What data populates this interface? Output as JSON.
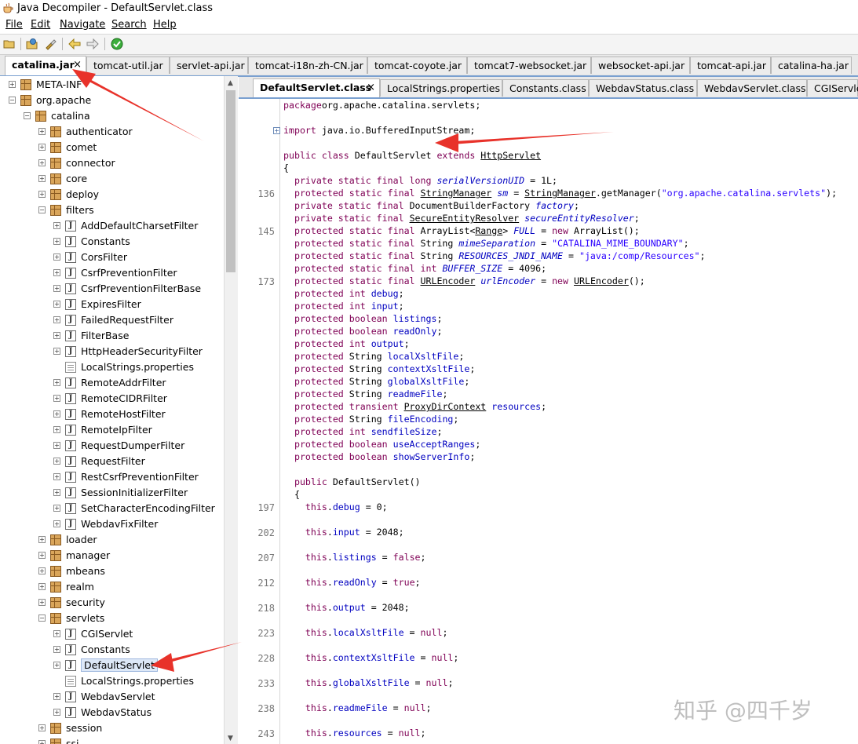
{
  "window": {
    "title": "Java Decompiler - DefaultServlet.class"
  },
  "menu": [
    "File",
    "Edit",
    "Navigate",
    "Search",
    "Help"
  ],
  "jar_tabs": [
    "catalina.jar",
    "tomcat-util.jar",
    "servlet-api.jar",
    "tomcat-i18n-zh-CN.jar",
    "tomcat-coyote.jar",
    "tomcat7-websocket.jar",
    "websocket-api.jar",
    "tomcat-api.jar",
    "catalina-ha.jar"
  ],
  "tree": [
    {
      "label": "META-INF",
      "depth": 0,
      "icon": "package",
      "expander": "+"
    },
    {
      "label": "org.apache",
      "depth": 0,
      "icon": "package",
      "expander": "-"
    },
    {
      "label": "catalina",
      "depth": 1,
      "icon": "package",
      "expander": "-"
    },
    {
      "label": "authenticator",
      "depth": 2,
      "icon": "package",
      "expander": "+"
    },
    {
      "label": "comet",
      "depth": 2,
      "icon": "package",
      "expander": "+"
    },
    {
      "label": "connector",
      "depth": 2,
      "icon": "package",
      "expander": "+"
    },
    {
      "label": "core",
      "depth": 2,
      "icon": "package",
      "expander": "+"
    },
    {
      "label": "deploy",
      "depth": 2,
      "icon": "package",
      "expander": "+"
    },
    {
      "label": "filters",
      "depth": 2,
      "icon": "package",
      "expander": "-"
    },
    {
      "label": "AddDefaultCharsetFilter",
      "depth": 3,
      "icon": "class",
      "expander": "+"
    },
    {
      "label": "Constants",
      "depth": 3,
      "icon": "class",
      "expander": "+"
    },
    {
      "label": "CorsFilter",
      "depth": 3,
      "icon": "class",
      "expander": "+"
    },
    {
      "label": "CsrfPreventionFilter",
      "depth": 3,
      "icon": "class",
      "expander": "+"
    },
    {
      "label": "CsrfPreventionFilterBase",
      "depth": 3,
      "icon": "class",
      "expander": "+"
    },
    {
      "label": "ExpiresFilter",
      "depth": 3,
      "icon": "class",
      "expander": "+"
    },
    {
      "label": "FailedRequestFilter",
      "depth": 3,
      "icon": "class",
      "expander": "+"
    },
    {
      "label": "FilterBase",
      "depth": 3,
      "icon": "class",
      "expander": "+"
    },
    {
      "label": "HttpHeaderSecurityFilter",
      "depth": 3,
      "icon": "class",
      "expander": "+"
    },
    {
      "label": "LocalStrings.properties",
      "depth": 3,
      "icon": "properties",
      "expander": ""
    },
    {
      "label": "RemoteAddrFilter",
      "depth": 3,
      "icon": "class",
      "expander": "+"
    },
    {
      "label": "RemoteCIDRFilter",
      "depth": 3,
      "icon": "class",
      "expander": "+"
    },
    {
      "label": "RemoteHostFilter",
      "depth": 3,
      "icon": "class",
      "expander": "+"
    },
    {
      "label": "RemoteIpFilter",
      "depth": 3,
      "icon": "class",
      "expander": "+"
    },
    {
      "label": "RequestDumperFilter",
      "depth": 3,
      "icon": "class",
      "expander": "+"
    },
    {
      "label": "RequestFilter",
      "depth": 3,
      "icon": "class",
      "expander": "+"
    },
    {
      "label": "RestCsrfPreventionFilter",
      "depth": 3,
      "icon": "class",
      "expander": "+"
    },
    {
      "label": "SessionInitializerFilter",
      "depth": 3,
      "icon": "class",
      "expander": "+"
    },
    {
      "label": "SetCharacterEncodingFilter",
      "depth": 3,
      "icon": "class",
      "expander": "+"
    },
    {
      "label": "WebdavFixFilter",
      "depth": 3,
      "icon": "class",
      "expander": "+"
    },
    {
      "label": "loader",
      "depth": 2,
      "icon": "package",
      "expander": "+"
    },
    {
      "label": "manager",
      "depth": 2,
      "icon": "package",
      "expander": "+"
    },
    {
      "label": "mbeans",
      "depth": 2,
      "icon": "package",
      "expander": "+"
    },
    {
      "label": "realm",
      "depth": 2,
      "icon": "package",
      "expander": "+"
    },
    {
      "label": "security",
      "depth": 2,
      "icon": "package",
      "expander": "+"
    },
    {
      "label": "servlets",
      "depth": 2,
      "icon": "package",
      "expander": "-"
    },
    {
      "label": "CGIServlet",
      "depth": 3,
      "icon": "class",
      "expander": "+"
    },
    {
      "label": "Constants",
      "depth": 3,
      "icon": "class",
      "expander": "+"
    },
    {
      "label": "DefaultServlet",
      "depth": 3,
      "icon": "class",
      "expander": "+",
      "selected": true
    },
    {
      "label": "LocalStrings.properties",
      "depth": 3,
      "icon": "properties",
      "expander": ""
    },
    {
      "label": "WebdavServlet",
      "depth": 3,
      "icon": "class",
      "expander": "+"
    },
    {
      "label": "WebdavStatus",
      "depth": 3,
      "icon": "class",
      "expander": "+"
    },
    {
      "label": "session",
      "depth": 2,
      "icon": "package",
      "expander": "+"
    },
    {
      "label": "ssi",
      "depth": 2,
      "icon": "package",
      "expander": "+"
    }
  ],
  "class_tabs": [
    "DefaultServlet.class",
    "LocalStrings.properties",
    "Constants.class",
    "WebdavStatus.class",
    "WebdavServlet.class",
    "CGIServlet"
  ],
  "code": [
    {
      "ln": "",
      "segs": [
        [
          "kw",
          "package"
        ],
        [
          "",
          "org.apache.catalina.servlets;"
        ]
      ]
    },
    {
      "ln": "",
      "segs": []
    },
    {
      "ln": "",
      "segs": [
        [
          "kw",
          "import"
        ],
        [
          "",
          " java.io.BufferedInputStream;"
        ]
      ]
    },
    {
      "ln": "",
      "segs": []
    },
    {
      "ln": "",
      "segs": [
        [
          "kw",
          "public class "
        ],
        [
          "",
          "DefaultServlet "
        ],
        [
          "kw",
          "extends "
        ],
        [
          "ul",
          "HttpServlet"
        ]
      ]
    },
    {
      "ln": "",
      "segs": [
        [
          "",
          "{"
        ]
      ]
    },
    {
      "ln": "",
      "segs": [
        [
          "",
          "  "
        ],
        [
          "kw",
          "private static final long "
        ],
        [
          "it",
          "serialVersionUID"
        ],
        [
          "",
          " = 1L;"
        ]
      ]
    },
    {
      "ln": "136",
      "segs": [
        [
          "",
          "  "
        ],
        [
          "kw",
          "protected static final "
        ],
        [
          "ul",
          "StringManager"
        ],
        [
          "",
          " "
        ],
        [
          "it",
          "sm"
        ],
        [
          "",
          " = "
        ],
        [
          "ul",
          "StringManager"
        ],
        [
          "",
          ".getManager("
        ],
        [
          "str",
          "\"org.apache.catalina.servlets\""
        ],
        [
          "",
          ");"
        ]
      ]
    },
    {
      "ln": "",
      "segs": [
        [
          "",
          "  "
        ],
        [
          "kw",
          "private static final "
        ],
        [
          "",
          "DocumentBuilderFactory "
        ],
        [
          "it",
          "factory"
        ],
        [
          "",
          ";"
        ]
      ]
    },
    {
      "ln": "",
      "segs": [
        [
          "",
          "  "
        ],
        [
          "kw",
          "private static final "
        ],
        [
          "ul",
          "SecureEntityResolver"
        ],
        [
          "",
          " "
        ],
        [
          "it",
          "secureEntityResolver"
        ],
        [
          "",
          ";"
        ]
      ]
    },
    {
      "ln": "145",
      "segs": [
        [
          "",
          "  "
        ],
        [
          "kw",
          "protected static final "
        ],
        [
          "",
          "ArrayList<"
        ],
        [
          "ul",
          "Range"
        ],
        [
          "",
          "> "
        ],
        [
          "it",
          "FULL"
        ],
        [
          "",
          " = "
        ],
        [
          "kw",
          "new "
        ],
        [
          "",
          "ArrayList();"
        ]
      ]
    },
    {
      "ln": "",
      "segs": [
        [
          "",
          "  "
        ],
        [
          "kw",
          "protected static final "
        ],
        [
          "",
          "String "
        ],
        [
          "it",
          "mimeSeparation"
        ],
        [
          "",
          " = "
        ],
        [
          "str",
          "\"CATALINA_MIME_BOUNDARY\""
        ],
        [
          "",
          ";"
        ]
      ]
    },
    {
      "ln": "",
      "segs": [
        [
          "",
          "  "
        ],
        [
          "kw",
          "protected static final "
        ],
        [
          "",
          "String "
        ],
        [
          "it",
          "RESOURCES_JNDI_NAME"
        ],
        [
          "",
          " = "
        ],
        [
          "str",
          "\"java:/comp/Resources\""
        ],
        [
          "",
          ";"
        ]
      ]
    },
    {
      "ln": "",
      "segs": [
        [
          "",
          "  "
        ],
        [
          "kw",
          "protected static final int "
        ],
        [
          "it",
          "BUFFER_SIZE"
        ],
        [
          "",
          " = 4096;"
        ]
      ]
    },
    {
      "ln": "173",
      "segs": [
        [
          "",
          "  "
        ],
        [
          "kw",
          "protected static final "
        ],
        [
          "ul",
          "URLEncoder"
        ],
        [
          "",
          " "
        ],
        [
          "it",
          "urlEncoder"
        ],
        [
          "",
          " = "
        ],
        [
          "kw",
          "new "
        ],
        [
          "ul",
          "URLEncoder"
        ],
        [
          "",
          "();"
        ]
      ]
    },
    {
      "ln": "",
      "segs": [
        [
          "",
          "  "
        ],
        [
          "kw",
          "protected int "
        ],
        [
          "fd",
          "debug"
        ],
        [
          "",
          ";"
        ]
      ]
    },
    {
      "ln": "",
      "segs": [
        [
          "",
          "  "
        ],
        [
          "kw",
          "protected int "
        ],
        [
          "fd",
          "input"
        ],
        [
          "",
          ";"
        ]
      ]
    },
    {
      "ln": "",
      "segs": [
        [
          "",
          "  "
        ],
        [
          "kw",
          "protected boolean "
        ],
        [
          "fd",
          "listings"
        ],
        [
          "",
          ";"
        ]
      ]
    },
    {
      "ln": "",
      "segs": [
        [
          "",
          "  "
        ],
        [
          "kw",
          "protected boolean "
        ],
        [
          "fd",
          "readOnly"
        ],
        [
          "",
          ";"
        ]
      ]
    },
    {
      "ln": "",
      "segs": [
        [
          "",
          "  "
        ],
        [
          "kw",
          "protected int "
        ],
        [
          "fd",
          "output"
        ],
        [
          "",
          ";"
        ]
      ]
    },
    {
      "ln": "",
      "segs": [
        [
          "",
          "  "
        ],
        [
          "kw",
          "protected "
        ],
        [
          "",
          "String "
        ],
        [
          "fd",
          "localXsltFile"
        ],
        [
          "",
          ";"
        ]
      ]
    },
    {
      "ln": "",
      "segs": [
        [
          "",
          "  "
        ],
        [
          "kw",
          "protected "
        ],
        [
          "",
          "String "
        ],
        [
          "fd",
          "contextXsltFile"
        ],
        [
          "",
          ";"
        ]
      ]
    },
    {
      "ln": "",
      "segs": [
        [
          "",
          "  "
        ],
        [
          "kw",
          "protected "
        ],
        [
          "",
          "String "
        ],
        [
          "fd",
          "globalXsltFile"
        ],
        [
          "",
          ";"
        ]
      ]
    },
    {
      "ln": "",
      "segs": [
        [
          "",
          "  "
        ],
        [
          "kw",
          "protected "
        ],
        [
          "",
          "String "
        ],
        [
          "fd",
          "readmeFile"
        ],
        [
          "",
          ";"
        ]
      ]
    },
    {
      "ln": "",
      "segs": [
        [
          "",
          "  "
        ],
        [
          "kw",
          "protected transient "
        ],
        [
          "ul",
          "ProxyDirContext"
        ],
        [
          "",
          " "
        ],
        [
          "fd",
          "resources"
        ],
        [
          "",
          ";"
        ]
      ]
    },
    {
      "ln": "",
      "segs": [
        [
          "",
          "  "
        ],
        [
          "kw",
          "protected "
        ],
        [
          "",
          "String "
        ],
        [
          "fd",
          "fileEncoding"
        ],
        [
          "",
          ";"
        ]
      ]
    },
    {
      "ln": "",
      "segs": [
        [
          "",
          "  "
        ],
        [
          "kw",
          "protected int "
        ],
        [
          "fd",
          "sendfileSize"
        ],
        [
          "",
          ";"
        ]
      ]
    },
    {
      "ln": "",
      "segs": [
        [
          "",
          "  "
        ],
        [
          "kw",
          "protected boolean "
        ],
        [
          "fd",
          "useAcceptRanges"
        ],
        [
          "",
          ";"
        ]
      ]
    },
    {
      "ln": "",
      "segs": [
        [
          "",
          "  "
        ],
        [
          "kw",
          "protected boolean "
        ],
        [
          "fd",
          "showServerInfo"
        ],
        [
          "",
          ";"
        ]
      ]
    },
    {
      "ln": "",
      "segs": []
    },
    {
      "ln": "",
      "segs": [
        [
          "",
          "  "
        ],
        [
          "kw",
          "public "
        ],
        [
          "",
          "DefaultServlet()"
        ]
      ]
    },
    {
      "ln": "",
      "segs": [
        [
          "",
          "  {"
        ]
      ]
    },
    {
      "ln": "197",
      "segs": [
        [
          "",
          "    "
        ],
        [
          "kw",
          "this"
        ],
        [
          "",
          "."
        ],
        [
          "fd",
          "debug"
        ],
        [
          "",
          " = 0;"
        ]
      ]
    },
    {
      "ln": "",
      "segs": []
    },
    {
      "ln": "202",
      "segs": [
        [
          "",
          "    "
        ],
        [
          "kw",
          "this"
        ],
        [
          "",
          "."
        ],
        [
          "fd",
          "input"
        ],
        [
          "",
          " = 2048;"
        ]
      ]
    },
    {
      "ln": "",
      "segs": []
    },
    {
      "ln": "207",
      "segs": [
        [
          "",
          "    "
        ],
        [
          "kw",
          "this"
        ],
        [
          "",
          "."
        ],
        [
          "fd",
          "listings"
        ],
        [
          "",
          " = "
        ],
        [
          "kw",
          "false"
        ],
        [
          "",
          ";"
        ]
      ]
    },
    {
      "ln": "",
      "segs": []
    },
    {
      "ln": "212",
      "segs": [
        [
          "",
          "    "
        ],
        [
          "kw",
          "this"
        ],
        [
          "",
          "."
        ],
        [
          "fd",
          "readOnly"
        ],
        [
          "",
          " = "
        ],
        [
          "kw",
          "true"
        ],
        [
          "",
          ";"
        ]
      ]
    },
    {
      "ln": "",
      "segs": []
    },
    {
      "ln": "218",
      "segs": [
        [
          "",
          "    "
        ],
        [
          "kw",
          "this"
        ],
        [
          "",
          "."
        ],
        [
          "fd",
          "output"
        ],
        [
          "",
          " = 2048;"
        ]
      ]
    },
    {
      "ln": "",
      "segs": []
    },
    {
      "ln": "223",
      "segs": [
        [
          "",
          "    "
        ],
        [
          "kw",
          "this"
        ],
        [
          "",
          "."
        ],
        [
          "fd",
          "localXsltFile"
        ],
        [
          "",
          " = "
        ],
        [
          "kw",
          "null"
        ],
        [
          "",
          ";"
        ]
      ]
    },
    {
      "ln": "",
      "segs": []
    },
    {
      "ln": "228",
      "segs": [
        [
          "",
          "    "
        ],
        [
          "kw",
          "this"
        ],
        [
          "",
          "."
        ],
        [
          "fd",
          "contextXsltFile"
        ],
        [
          "",
          " = "
        ],
        [
          "kw",
          "null"
        ],
        [
          "",
          ";"
        ]
      ]
    },
    {
      "ln": "",
      "segs": []
    },
    {
      "ln": "233",
      "segs": [
        [
          "",
          "    "
        ],
        [
          "kw",
          "this"
        ],
        [
          "",
          "."
        ],
        [
          "fd",
          "globalXsltFile"
        ],
        [
          "",
          " = "
        ],
        [
          "kw",
          "null"
        ],
        [
          "",
          ";"
        ]
      ]
    },
    {
      "ln": "",
      "segs": []
    },
    {
      "ln": "238",
      "segs": [
        [
          "",
          "    "
        ],
        [
          "kw",
          "this"
        ],
        [
          "",
          "."
        ],
        [
          "fd",
          "readmeFile"
        ],
        [
          "",
          " = "
        ],
        [
          "kw",
          "null"
        ],
        [
          "",
          ";"
        ]
      ]
    },
    {
      "ln": "",
      "segs": []
    },
    {
      "ln": "243",
      "segs": [
        [
          "",
          "    "
        ],
        [
          "kw",
          "this"
        ],
        [
          "",
          "."
        ],
        [
          "fd",
          "resources"
        ],
        [
          "",
          " = "
        ],
        [
          "kw",
          "null"
        ],
        [
          "",
          ";"
        ]
      ]
    }
  ],
  "watermark": "知乎 @四千岁",
  "colors": {
    "keyword": "#7f0055",
    "field": "#0000c0",
    "string": "#2a00ff",
    "arrow": "#e8322a",
    "tab_underline": "#7aa0d0"
  }
}
